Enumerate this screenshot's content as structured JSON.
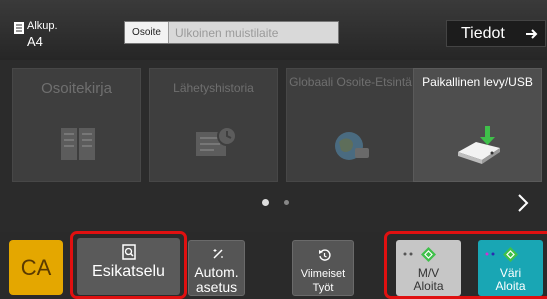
{
  "header": {
    "original_label": "Alkup.",
    "original_size": "A4",
    "address_label": "Osoite",
    "address_placeholder": "Ulkoinen muistilaite",
    "details_label": "Tiedot"
  },
  "tiles": [
    {
      "label": "Osoitekirja",
      "active": false,
      "icon": "address-book-icon"
    },
    {
      "label": "Lähetyshistoria",
      "active": false,
      "icon": "send-history-icon"
    },
    {
      "label": "Globaali Osoite-Etsintä",
      "active": false,
      "icon": "global-search-icon"
    },
    {
      "label": "Paikallinen levy/USB",
      "active": true,
      "icon": "usb-drive-icon"
    }
  ],
  "pager": {
    "current_page": 1,
    "total_pages": 2
  },
  "bottom": {
    "ca_label": "CA",
    "preview_label": "Esikatselu",
    "auto_label_1": "Autom.",
    "auto_label_2": "asetus",
    "recent_label_1": "Viimeiset",
    "recent_label_2": "Työt",
    "start_bw_label_1": "M/V",
    "start_bw_label_2": "Aloita",
    "start_color_label_1": "Väri",
    "start_color_label_2": "Aloita"
  },
  "colors": {
    "ca": "#e4a700",
    "start_color": "#19a6b4",
    "start_bw": "#c6c6c6",
    "diamond": "#3fc04a",
    "highlight": "#e01010"
  }
}
